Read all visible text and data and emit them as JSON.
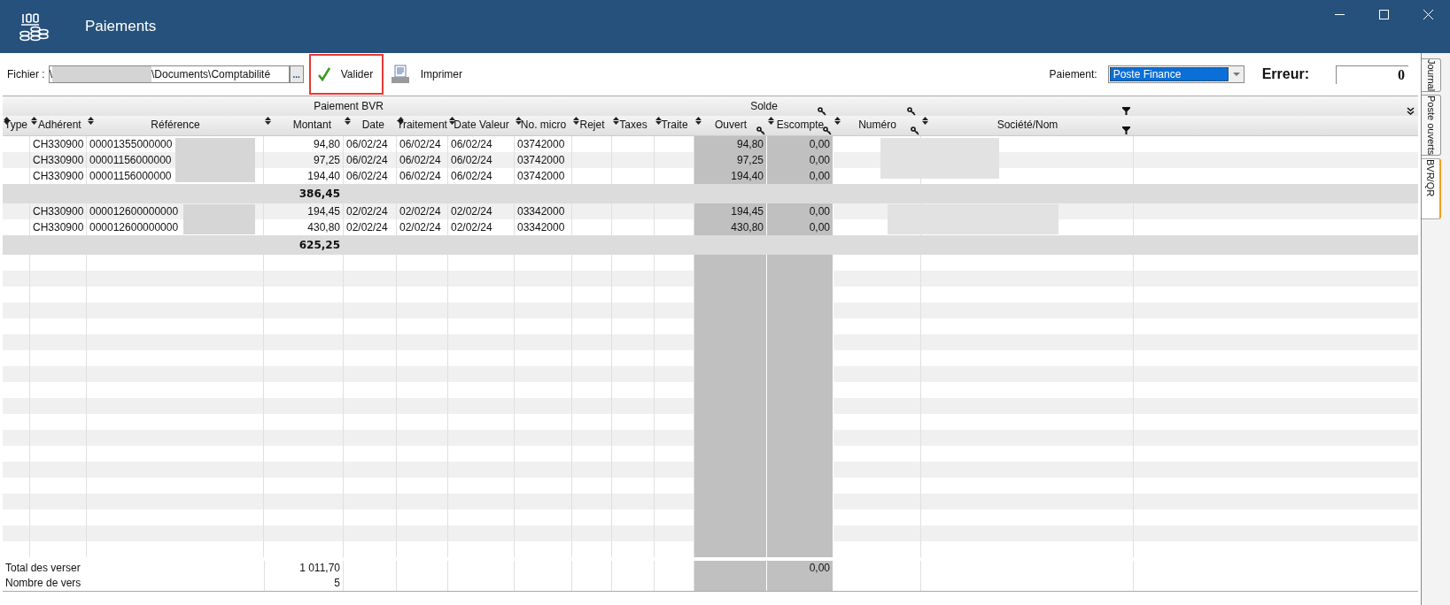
{
  "window": {
    "title": "Paiements"
  },
  "toolbar": {
    "file_label": "Fichier :",
    "file_path_start": "\\",
    "file_path_end": "\\Documents\\Comptabilité",
    "browse_button": "...",
    "validate_button": {
      "label": "Valider",
      "highlighted": true
    },
    "print_button": "Imprimer",
    "payment_label": "Paiement:",
    "payment_value": "Poste Finance",
    "error_label": "Erreur:",
    "error_value": "0"
  },
  "table": {
    "column_groups": [
      "Paiement BVR",
      "Solde"
    ],
    "columns": [
      "Type",
      "Adhérent",
      "Référence",
      "Montant",
      "Date",
      "Traitement",
      "Date Valeur",
      "No. micro",
      "Rejet",
      "Taxes",
      "Traite",
      "Ouvert",
      "Escompte",
      "Numéro",
      "Société/Nom"
    ],
    "groups": [
      {
        "rows": [
          {
            "adherent": "CH330900",
            "reference": "00001355000000",
            "montant": "94,80",
            "date": "06/02/24",
            "traitement": "06/02/24",
            "date_valeur": "06/02/24",
            "no_micro": "03742000",
            "ouvert": "94,80",
            "escompte": "0,00"
          },
          {
            "adherent": "CH330900",
            "reference": "00001156000000",
            "montant": "97,25",
            "date": "06/02/24",
            "traitement": "06/02/24",
            "date_valeur": "06/02/24",
            "no_micro": "03742000",
            "ouvert": "97,25",
            "escompte": "0,00"
          },
          {
            "adherent": "CH330900",
            "reference": "00001156000000",
            "montant": "194,40",
            "date": "06/02/24",
            "traitement": "06/02/24",
            "date_valeur": "06/02/24",
            "no_micro": "03742000",
            "ouvert": "194,40",
            "escompte": "0,00"
          }
        ],
        "total": "386,45"
      },
      {
        "rows": [
          {
            "adherent": "CH330900",
            "reference": "000012600000000",
            "montant": "194,45",
            "date": "02/02/24",
            "traitement": "02/02/24",
            "date_valeur": "02/02/24",
            "no_micro": "03342000",
            "ouvert": "194,45",
            "escompte": "0,00"
          },
          {
            "adherent": "CH330900",
            "reference": "000012600000000",
            "montant": "430,80",
            "date": "02/02/24",
            "traitement": "02/02/24",
            "date_valeur": "02/02/24",
            "no_micro": "03342000",
            "ouvert": "430,80",
            "escompte": "0,00"
          }
        ],
        "total": "625,25"
      }
    ],
    "footer": {
      "total_label": "Total des verser",
      "total_montant": "1 011,70",
      "total_escompte": "0,00",
      "count_label": "Nombre de vers",
      "count_montant": "5"
    }
  },
  "side_tabs": [
    {
      "label": "Journal",
      "selected": false
    },
    {
      "label": "Poste ouverts",
      "selected": false
    },
    {
      "label": "BVR/QR",
      "selected": true
    }
  ]
}
